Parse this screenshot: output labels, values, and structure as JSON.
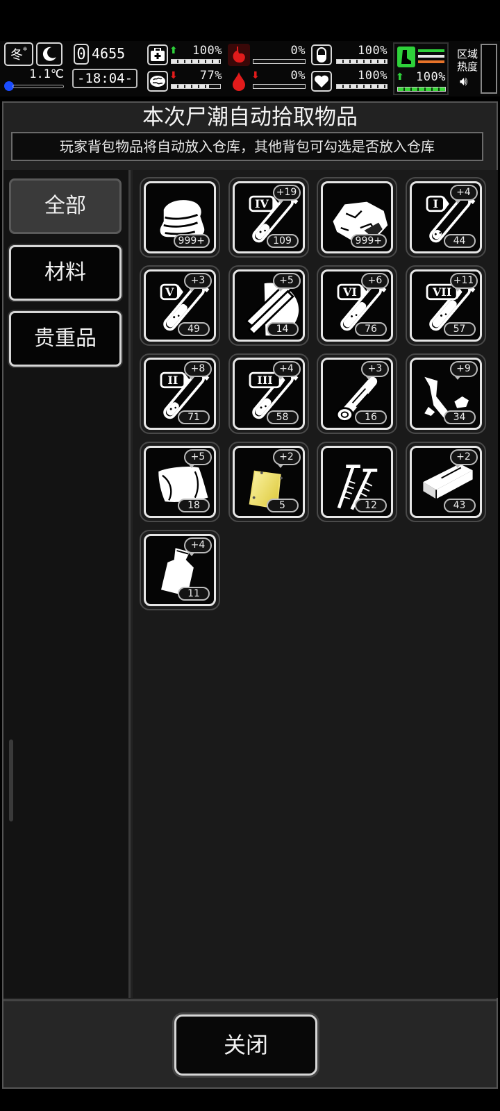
{
  "status": {
    "season": "冬",
    "temperature": "1.1℃",
    "day": "0",
    "score": "4655",
    "time": "-18:04-",
    "stats": [
      {
        "name": "medical",
        "icon": "medkit-icon",
        "value": "100%",
        "level": 1.0,
        "trend": "up"
      },
      {
        "name": "brain",
        "icon": "brain-icon",
        "value": "77%",
        "level": 0.77,
        "trend": "down"
      },
      {
        "name": "stomach",
        "icon": "stomach-icon",
        "value": "0%",
        "level": 0.0,
        "trend": "none"
      },
      {
        "name": "blood",
        "icon": "blood-drop-icon",
        "value": "0%",
        "level": 0.0,
        "trend": "down"
      },
      {
        "name": "pill",
        "icon": "pill-icon",
        "value": "100%",
        "level": 1.0,
        "trend": "none"
      },
      {
        "name": "heart",
        "icon": "heart-icon",
        "value": "100%",
        "level": 1.0,
        "trend": "none"
      },
      {
        "name": "stamina",
        "icon": "boot-icon",
        "value": "100%",
        "level": 1.0,
        "trend": "up"
      }
    ],
    "zone_label": "区域热度",
    "colors": {
      "green": "#2ed13a",
      "red": "#e21b1b",
      "orange": "#e8742a"
    }
  },
  "panel": {
    "title": "本次尸潮自动拾取物品",
    "subtitle": "玩家背包物品将自动放入仓库，其他背包可勾选是否放入仓库"
  },
  "tabs": [
    {
      "label": "全部",
      "active": true
    },
    {
      "label": "材料",
      "active": false
    },
    {
      "label": "贵重品",
      "active": false
    }
  ],
  "items": [
    {
      "icon": "cloth-icon",
      "count": "999+",
      "plus": ""
    },
    {
      "icon": "test-tube-iv-icon",
      "count": "109",
      "plus": "+19",
      "numeral": "IV",
      "fill": 0.35
    },
    {
      "icon": "ore-rock-icon",
      "count": "999+",
      "plus": ""
    },
    {
      "icon": "test-tube-i-icon",
      "count": "44",
      "plus": "+4",
      "numeral": "I",
      "fill": 0.2
    },
    {
      "icon": "test-tube-v-icon",
      "count": "49",
      "plus": "+3",
      "numeral": "V",
      "fill": 0.55
    },
    {
      "icon": "wood-planks-icon",
      "count": "14",
      "plus": "+5"
    },
    {
      "icon": "test-tube-vi-icon",
      "count": "76",
      "plus": "+6",
      "numeral": "VI",
      "fill": 0.6
    },
    {
      "icon": "test-tube-vii-icon",
      "count": "57",
      "plus": "+11",
      "numeral": "VII",
      "fill": 0.65
    },
    {
      "icon": "test-tube-ii-icon",
      "count": "71",
      "plus": "+8",
      "numeral": "II",
      "fill": 0.3
    },
    {
      "icon": "test-tube-iii-icon",
      "count": "58",
      "plus": "+4",
      "numeral": "III",
      "fill": 0.4
    },
    {
      "icon": "log-icon",
      "count": "16",
      "plus": "+3"
    },
    {
      "icon": "scrap-metal-icon",
      "count": "34",
      "plus": "+9"
    },
    {
      "icon": "leather-icon",
      "count": "18",
      "plus": "+5"
    },
    {
      "icon": "gold-plate-icon",
      "count": "5",
      "plus": "+2"
    },
    {
      "icon": "screws-icon",
      "count": "12",
      "plus": ""
    },
    {
      "icon": "brick-icon",
      "count": "43",
      "plus": "+2"
    },
    {
      "icon": "plastic-bag-icon",
      "count": "11",
      "plus": "+4"
    }
  ],
  "close_label": "关闭"
}
